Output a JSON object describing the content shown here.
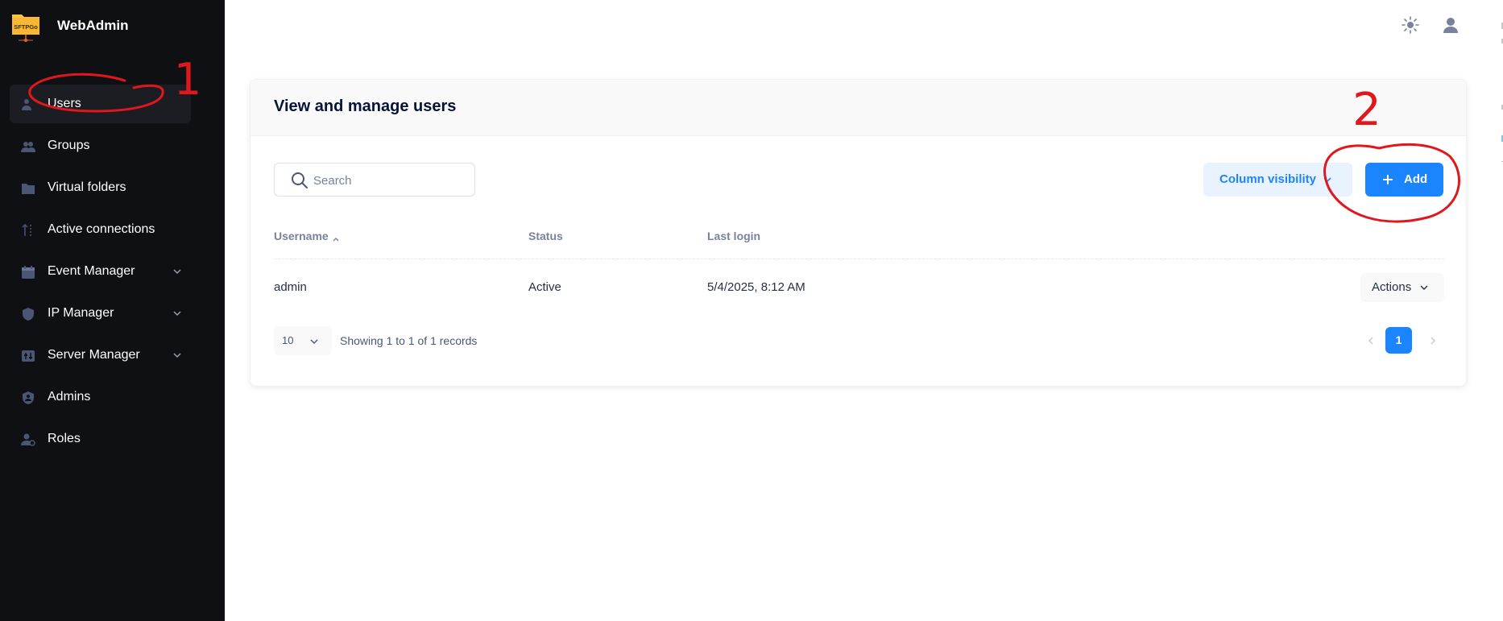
{
  "brand": {
    "logo_text": "SFTPGo",
    "name": "WebAdmin"
  },
  "sidebar": {
    "items": [
      {
        "label": "Users",
        "icon": "user-icon",
        "active": true
      },
      {
        "label": "Groups",
        "icon": "group-icon"
      },
      {
        "label": "Virtual folders",
        "icon": "folder-icon"
      },
      {
        "label": "Active connections",
        "icon": "connections-icon"
      },
      {
        "label": "Event Manager",
        "icon": "calendar-icon",
        "expandable": true
      },
      {
        "label": "IP Manager",
        "icon": "shield-icon",
        "expandable": true
      },
      {
        "label": "Server Manager",
        "icon": "server-icon",
        "expandable": true
      },
      {
        "label": "Admins",
        "icon": "admin-shield-icon"
      },
      {
        "label": "Roles",
        "icon": "role-icon"
      }
    ]
  },
  "topbar": {
    "theme_icon": "sun-icon",
    "user_icon": "user-avatar-icon"
  },
  "main": {
    "title": "View and manage users",
    "search": {
      "placeholder": "Search",
      "value": ""
    },
    "column_visibility_label": "Column visibility",
    "add_label": "Add",
    "table": {
      "columns": [
        "Username",
        "Status",
        "Last login"
      ],
      "sorted_column": "Username",
      "sort_direction": "ascending",
      "rows": [
        {
          "username": "admin",
          "status": "Active",
          "last_login": "5/4/2025, 8:12 AM",
          "actions_label": "Actions"
        }
      ]
    },
    "pagination": {
      "page_size": "10",
      "summary": "Showing 1 to 1 of 1 records",
      "current_page": "1"
    }
  },
  "annotations": {
    "marks": [
      "1",
      "2"
    ],
    "color": "#e0171c"
  },
  "colors": {
    "sidebar_bg": "#0f1014",
    "accent": "#1b84ff",
    "accent_light": "#e9f3ff",
    "logo": "#f6c344"
  }
}
